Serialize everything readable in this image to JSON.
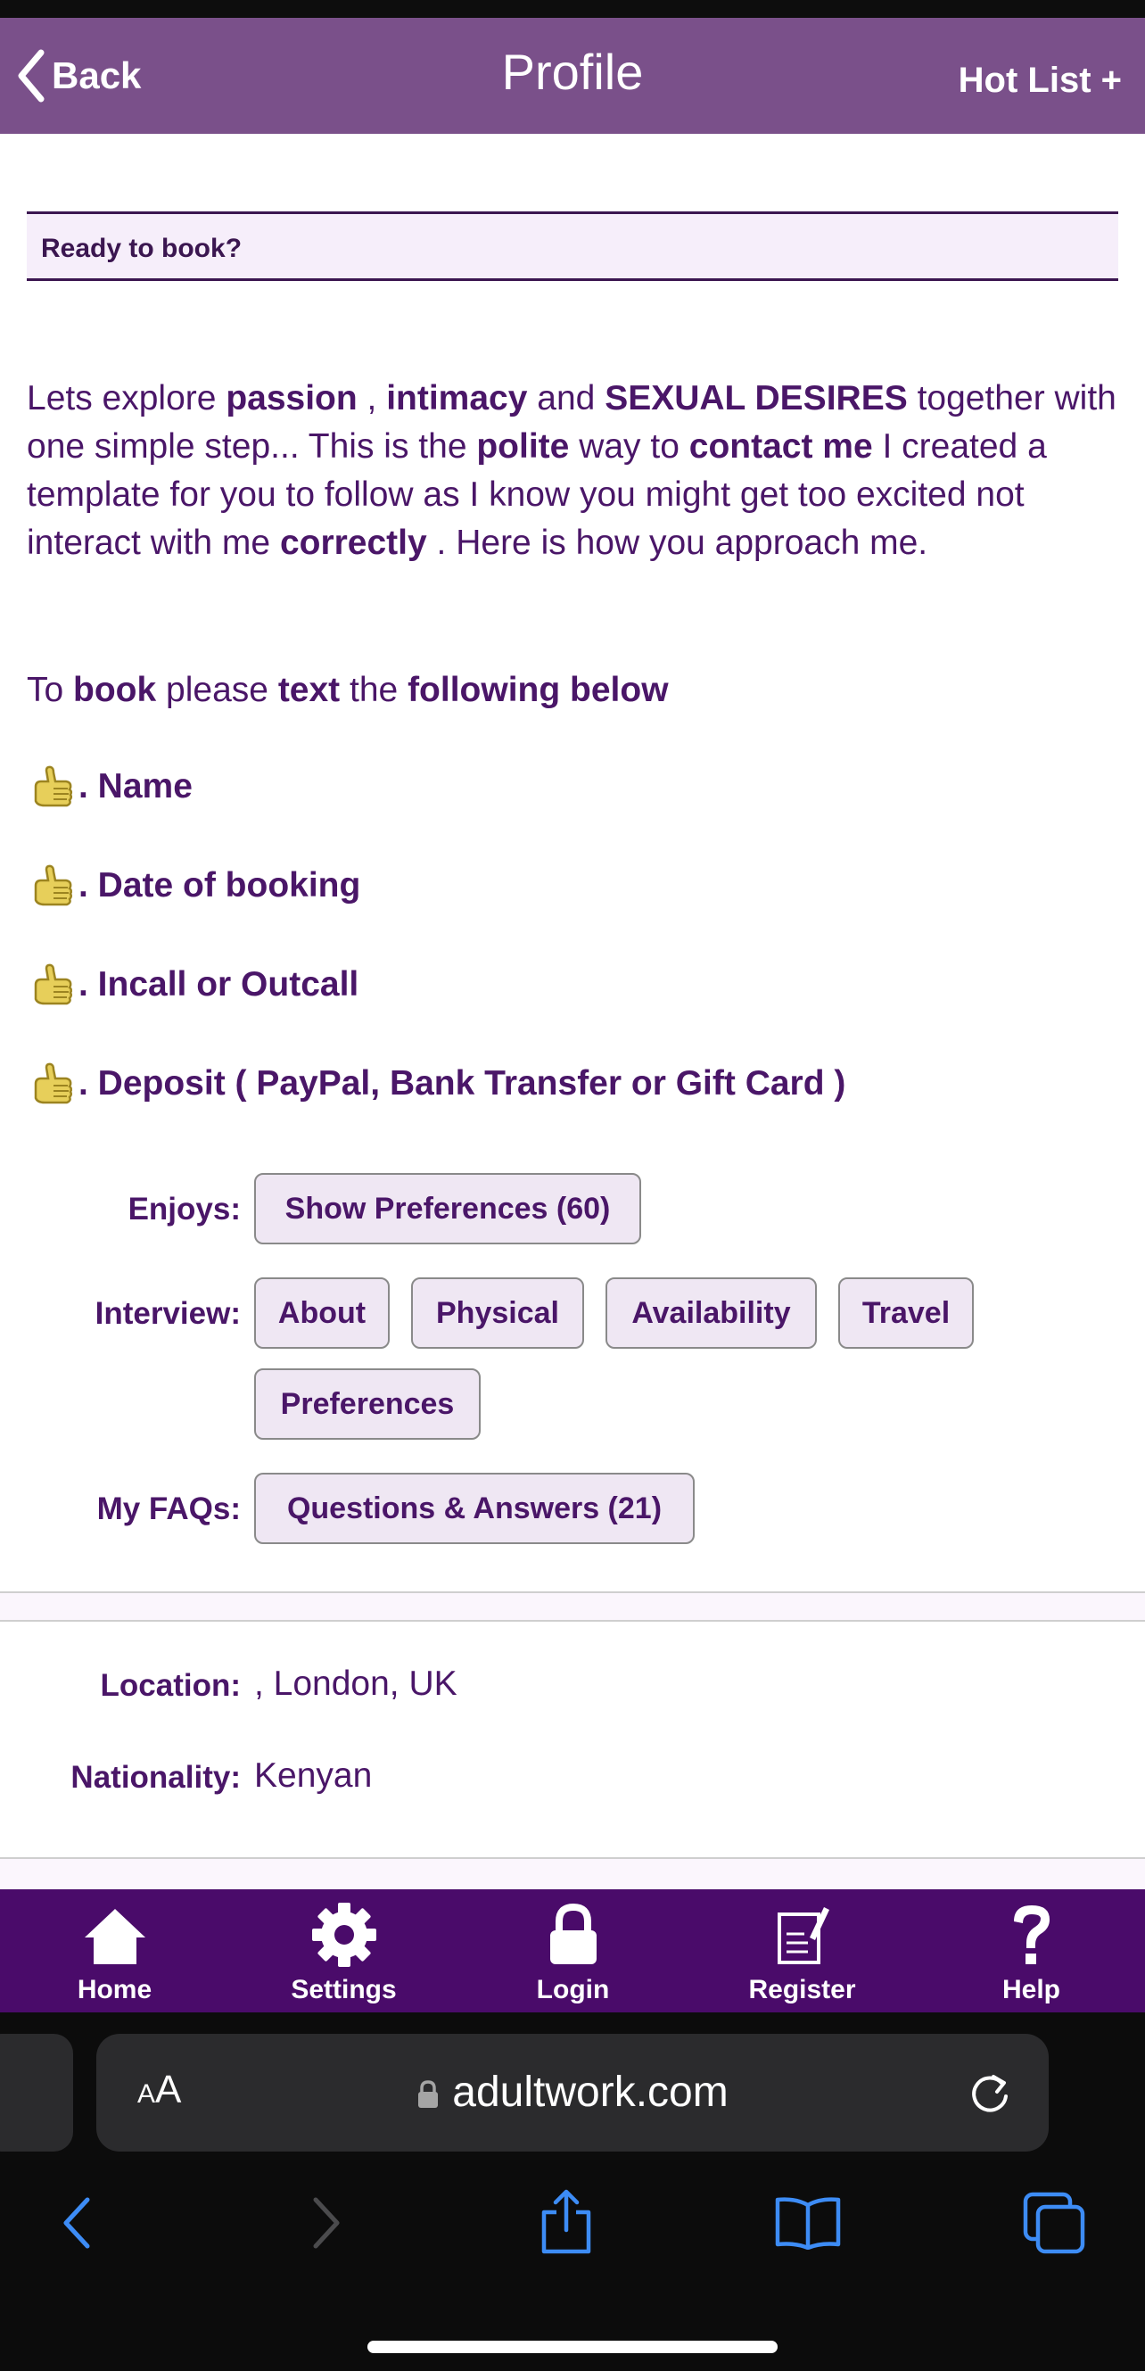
{
  "nav": {
    "back_label": "Back",
    "title": "Profile",
    "hotlist_label": "Hot List +"
  },
  "ready_box": {
    "label": "Ready to book?"
  },
  "intro": {
    "t1": "Lets explore ",
    "b1": "passion",
    "t2": " , ",
    "b2": "intimacy",
    "t3": " and ",
    "b3": "SEXUAL DESIRES",
    "t4": " together with one simple step... This is the ",
    "b4": "polite",
    "t5": " way to ",
    "b5": "contact me",
    "t6": " I created a template for you to follow as I know you might get too excited not interact with me ",
    "b6": "correctly",
    "t7": " . Here is how you approach me."
  },
  "to_book": {
    "t1": "To ",
    "b1": "book",
    "t2": " please ",
    "b2": "text",
    "t3": " the ",
    "b3": "following below"
  },
  "requirements": [
    {
      "icon": "thumbs-up-icon",
      "label": ". Name"
    },
    {
      "icon": "thumbs-up-icon",
      "label": ". Date of booking"
    },
    {
      "icon": "thumbs-up-icon",
      "label": ". Incall or Outcall"
    },
    {
      "icon": "thumbs-up-icon",
      "label": ". Deposit ( PayPal, Bank Transfer or Gift Card )"
    }
  ],
  "enjoys": {
    "label": "Enjoys:",
    "button": "Show Preferences (60)"
  },
  "interview": {
    "label": "Interview:",
    "buttons": [
      "About",
      "Physical",
      "Availability",
      "Travel",
      "Preferences"
    ]
  },
  "faqs": {
    "label": "My FAQs:",
    "button": "Questions & Answers (21)"
  },
  "details": {
    "location_label": "Location:",
    "location_value": ", London, UK",
    "nationality_label": "Nationality:",
    "nationality_value": "Kenyan"
  },
  "tabbar": {
    "items": [
      {
        "label": "Home",
        "icon": "home-icon"
      },
      {
        "label": "Settings",
        "icon": "gear-icon"
      },
      {
        "label": "Login",
        "icon": "lock-icon"
      },
      {
        "label": "Register",
        "icon": "register-icon"
      },
      {
        "label": "Help",
        "icon": "help-icon"
      }
    ]
  },
  "browser": {
    "aa_small": "A",
    "aa_large": "A",
    "url": "adultwork.com"
  },
  "colors": {
    "nav_bg": "#7a508a",
    "text_purple": "#4a1668",
    "tabbar_bg": "#4a0b6a",
    "pill_bg": "#efe7f3"
  }
}
